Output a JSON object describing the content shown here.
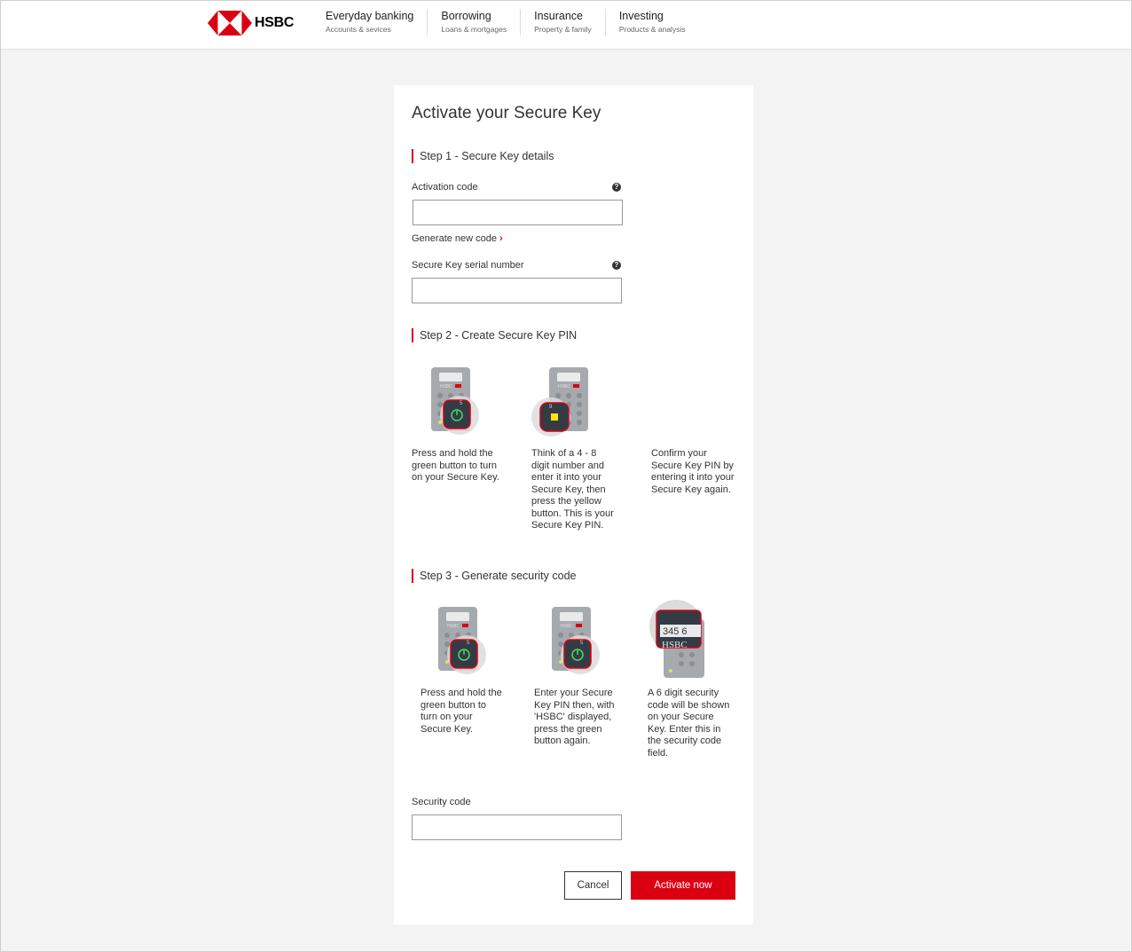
{
  "header": {
    "brand": "HSBC",
    "nav": [
      {
        "title": "Everyday banking",
        "sub": "Accounts & sevices"
      },
      {
        "title": "Borrowing",
        "sub": "Loans & mortgages"
      },
      {
        "title": "Insurance",
        "sub": "Property & family"
      },
      {
        "title": "Investing",
        "sub": "Products & analysis"
      }
    ]
  },
  "form": {
    "title": "Activate your Secure Key",
    "step1": {
      "title": "Step 1 - Secure Key details",
      "activation_label": "Activation code",
      "activation_value": "",
      "generate_link": "Generate new code",
      "serial_label": "Secure Key serial number",
      "serial_value": ""
    },
    "step2": {
      "title": "Step 2 - Create Secure Key PIN",
      "items": [
        {
          "text": "Press and hold the green button to turn on your Secure Key."
        },
        {
          "text": "Think of a 4 - 8 digit number and enter it into your Secure Key, then press the yellow button. This is your Secure Key PIN."
        },
        {
          "text": "Confirm your Secure Key PIN by entering it into your Secure Key again."
        }
      ]
    },
    "step3": {
      "title": "Step 3 - Generate security code",
      "items": [
        {
          "text": "Press and hold the green button to turn on your Secure Key."
        },
        {
          "text": "Enter your Secure Key PIN then, with 'HSBC' displayed, press the green button again."
        },
        {
          "text": "A 6 digit security code will be shown on your Secure Key. Enter this in the security code field."
        }
      ],
      "screen_code": "345 6",
      "screen_brand": "HSBC",
      "device_label": "HSBC"
    },
    "security_label": "Security code",
    "security_value": "",
    "cancel_label": "Cancel",
    "activate_label": "Activate now",
    "help_glyph": "?",
    "chevron_glyph": "›"
  },
  "colors": {
    "brand_red": "#db0011",
    "device_grey": "#9a9da1",
    "green_button": "#4cd964",
    "yellow_button": "#ffe600"
  }
}
